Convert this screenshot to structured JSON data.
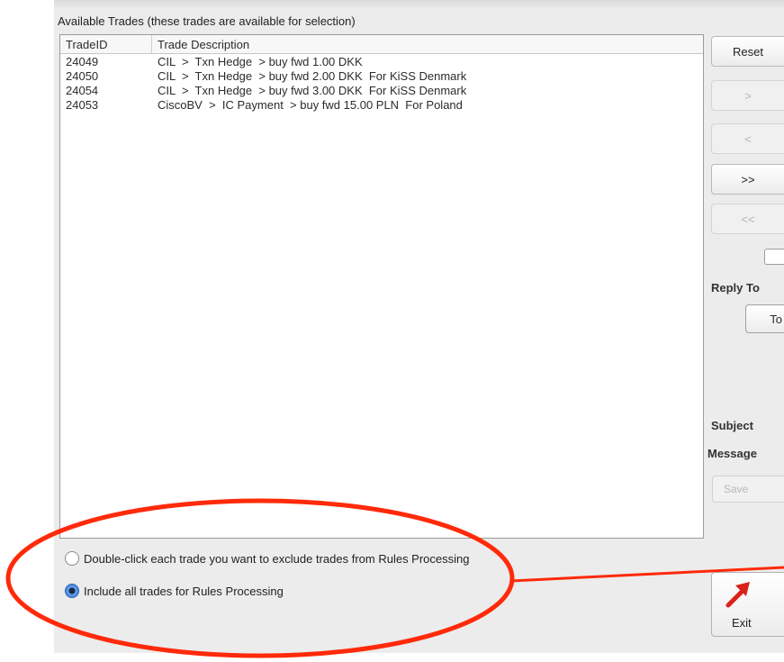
{
  "available_trades": {
    "title": "Available Trades (these trades are available for selection)",
    "columns": [
      "TradeID",
      "Trade Description"
    ],
    "rows": [
      {
        "id": "24049",
        "description": "CIL  >  Txn Hedge  > buy fwd 1.00 DKK"
      },
      {
        "id": "24050",
        "description": "CIL  >  Txn Hedge  > buy fwd 2.00 DKK  For KiSS Denmark"
      },
      {
        "id": "24054",
        "description": "CIL  >  Txn Hedge  > buy fwd 3.00 DKK  For KiSS Denmark"
      },
      {
        "id": "24053",
        "description": "CiscoBV  >  IC Payment  > buy fwd 15.00 PLN  For Poland"
      }
    ]
  },
  "side_panel": {
    "reset_label": "Reset",
    "move_right_label": ">",
    "move_left_label": "<",
    "move_all_right_label": ">>",
    "move_all_left_label": "<<",
    "reply_to_label": "Reply To",
    "to_label": "To",
    "subject_label": "Subject",
    "message_label": "Message",
    "save_label": "Save"
  },
  "rules_options": {
    "exclude_label": "Double-click each trade you want to exclude trades from Rules Processing",
    "include_all_label": "Include all trades for Rules Processing",
    "selected": "include_all"
  },
  "exit_label": "Exit",
  "colors": {
    "annotation": "#ff2a0a",
    "radio_selected": "#3a7dd6"
  }
}
